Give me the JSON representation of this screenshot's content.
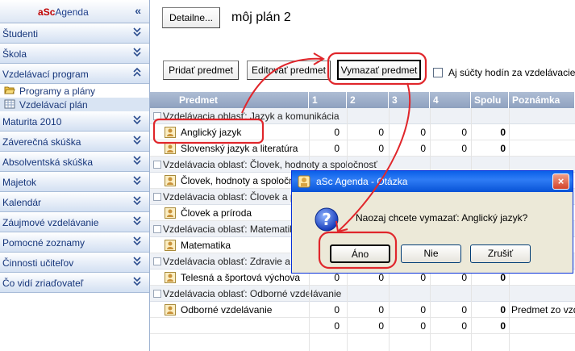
{
  "sidebar": {
    "brand_a": "a",
    "brand_sc": "Sc",
    "brand_rest": "Agenda",
    "collapse_glyph": "«",
    "expand_glyph": "»",
    "sections": [
      {
        "label": "Študenti"
      },
      {
        "label": "Škola"
      },
      {
        "label": "Vzdelávací program"
      }
    ],
    "sub_items": [
      {
        "label": "Programy a plány",
        "icon": "folder-open-icon"
      },
      {
        "label": "Vzdelávací plán",
        "icon": "table-icon"
      }
    ],
    "sections_after": [
      {
        "label": "Maturita 2010"
      },
      {
        "label": "Záverečná skúška"
      },
      {
        "label": "Absolventská skúška"
      },
      {
        "label": "Majetok"
      },
      {
        "label": "Kalendár"
      },
      {
        "label": "Záujmové vzdelávanie"
      },
      {
        "label": "Pomocné zoznamy"
      },
      {
        "label": "Činnosti učiteľov"
      },
      {
        "label": "Čo vidí zriaďovateľ"
      }
    ]
  },
  "toolbar": {
    "details_label": "Detailne...",
    "plan_title": "môj plán 2",
    "add_label": "Pridať predmet",
    "edit_label": "Editovať predmet",
    "delete_label": "Vymazať predmet",
    "checkbox_label": "Aj súčty hodín za vzdelávacie ob"
  },
  "grid": {
    "columns": [
      "Predmet",
      "1",
      "2",
      "3",
      "4",
      "Spolu",
      "Poznámka"
    ],
    "rows": [
      {
        "type": "group",
        "text": "Vzdelávacia oblasť: Jazyk a komunikácia"
      },
      {
        "type": "item",
        "text": "Anglický jazyk",
        "v": [
          "0",
          "0",
          "0",
          "0",
          "0"
        ],
        "note": ""
      },
      {
        "type": "item",
        "text": "Slovenský jazyk a literatúra",
        "v": [
          "0",
          "0",
          "0",
          "0",
          "0"
        ],
        "note": ""
      },
      {
        "type": "group",
        "text": "Vzdelávacia oblasť: Človek, hodnoty a spoločnosť"
      },
      {
        "type": "item",
        "text": "Človek, hodnoty a spoločnosť",
        "v": [
          "",
          "",
          "",
          "",
          ""
        ],
        "note": ""
      },
      {
        "type": "group",
        "text": "Vzdelávacia oblasť: Človek a príroda"
      },
      {
        "type": "item",
        "text": "Človek a príroda",
        "v": [
          "",
          "",
          "",
          "",
          ""
        ],
        "note": ""
      },
      {
        "type": "group",
        "text": "Vzdelávacia oblasť: Matematika"
      },
      {
        "type": "item",
        "text": "Matematika",
        "v": [
          "",
          "",
          "",
          "",
          ""
        ],
        "note": ""
      },
      {
        "type": "group",
        "text": "Vzdelávacia oblasť: Zdravie a pohyb"
      },
      {
        "type": "item",
        "text": "Telesná a športová výchova",
        "v": [
          "0",
          "0",
          "0",
          "0",
          "0"
        ],
        "note": ""
      },
      {
        "type": "group",
        "text": "Vzdelávacia oblasť: Odborné vzdelávanie"
      },
      {
        "type": "item",
        "text": "Odborné vzdelávanie",
        "v": [
          "0",
          "0",
          "0",
          "0",
          "0"
        ],
        "note": "Predmet zo vzdel"
      },
      {
        "type": "total",
        "text": "",
        "v": [
          "0",
          "0",
          "0",
          "0",
          "0"
        ],
        "note": ""
      }
    ]
  },
  "dialog": {
    "title": "aSc Agenda - Otázka",
    "message": "Naozaj chcete vymazať: Anglický jazyk?",
    "yes_label": "Áno",
    "no_label": "Nie",
    "cancel_label": "Zrušiť",
    "close_glyph": "×",
    "question_glyph": "?"
  },
  "colors": {
    "annotation_red": "#e0262b",
    "grid_header": "#9cadc8",
    "dialog_title": "#0a5fe8"
  }
}
